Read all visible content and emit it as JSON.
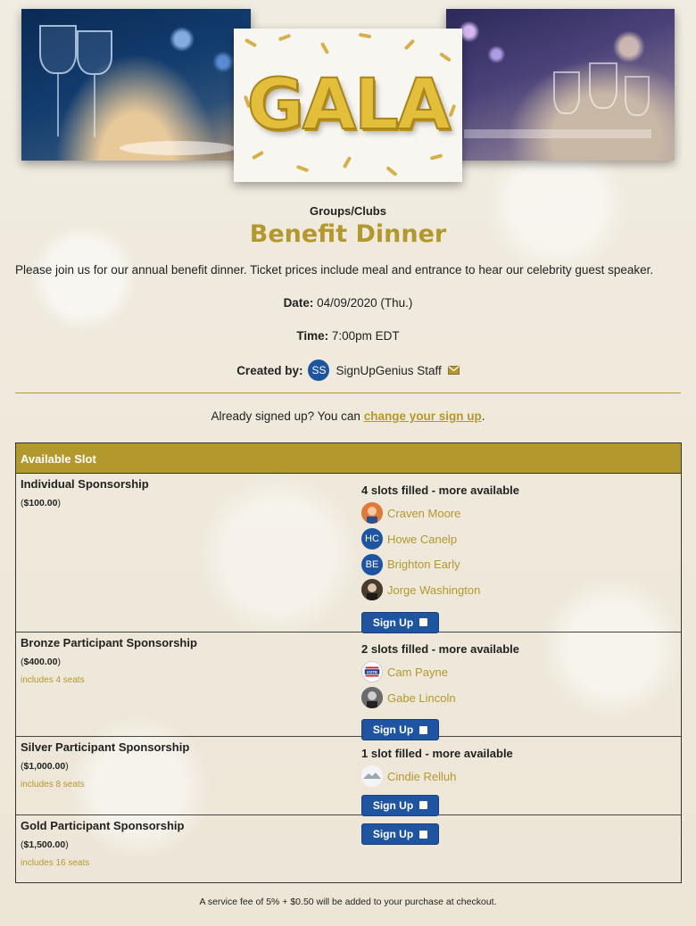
{
  "hero": {
    "gala_text": "GALA"
  },
  "category": "Groups/Clubs",
  "title": "Benefit Dinner",
  "description": "Please join us for our annual benefit dinner.  Ticket prices include meal and entrance to hear our celebrity guest speaker.",
  "date": {
    "label": "Date:",
    "value": "04/09/2020 (Thu.)"
  },
  "time": {
    "label": "Time:",
    "value": "7:00pm EDT"
  },
  "creator": {
    "label": "Created by:",
    "initials": "SS",
    "name": "SignUpGenius Staff",
    "icon": "mail-icon"
  },
  "already": {
    "text": "Already signed up? You can",
    "link": "change your sign up",
    "end": "."
  },
  "table": {
    "header": "Available Slot",
    "slots": [
      {
        "name": "Individual Sponsorship",
        "price": "$100.00",
        "note": "",
        "filled": "4 slots filled - more available",
        "participants": [
          {
            "name": "Craven Moore",
            "avatar": "photo",
            "initials": ""
          },
          {
            "name": "Howe Canelp",
            "avatar": "initials",
            "initials": "HC"
          },
          {
            "name": "Brighton Early",
            "avatar": "initials",
            "initials": "BE"
          },
          {
            "name": "Jorge Washington",
            "avatar": "photo",
            "initials": ""
          }
        ],
        "button": "Sign Up"
      },
      {
        "name": "Bronze Participant Sponsorship",
        "price": "$400.00",
        "note": "includes 4 seats",
        "filled": "2 slots filled - more available",
        "participants": [
          {
            "name": "Cam Payne",
            "avatar": "photo",
            "initials": ""
          },
          {
            "name": "Gabe Lincoln",
            "avatar": "photo",
            "initials": ""
          }
        ],
        "button": "Sign Up"
      },
      {
        "name": "Silver Participant Sponsorship",
        "price": "$1,000.00",
        "note": "includes 8 seats",
        "filled": "1 slot filled - more available",
        "participants": [
          {
            "name": "Cindie Relluh",
            "avatar": "photo",
            "initials": ""
          }
        ],
        "button": "Sign Up"
      },
      {
        "name": "Gold Participant Sponsorship",
        "price": "$1,500.00",
        "note": "includes 16 seats",
        "filled": "",
        "participants": [],
        "button": "Sign Up"
      }
    ]
  },
  "footer": "A service fee of 5% + $0.50 will be added to your purchase at checkout.",
  "colors": {
    "gold": "#b3982e",
    "blue": "#1f55a0"
  }
}
